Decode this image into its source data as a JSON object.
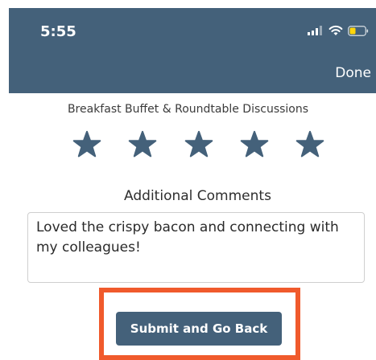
{
  "status_bar": {
    "time": "5:55"
  },
  "header": {
    "done_label": "Done"
  },
  "session": {
    "title": "Breakfast Buffet & Roundtable Discussions",
    "rating": 5,
    "max_rating": 5
  },
  "comments": {
    "label": "Additional Comments",
    "value": "Loved the crispy bacon and connecting with my colleagues!"
  },
  "actions": {
    "submit_label": "Submit and Go Back"
  },
  "colors": {
    "header_bg": "#44617a",
    "star": "#44617a",
    "button_bg": "#44617a",
    "highlight": "#f05a2c",
    "battery": "#ffd60a"
  },
  "icons": {
    "signal": "cellular-signal-icon",
    "wifi": "wifi-icon",
    "battery": "battery-icon",
    "star": "star-icon"
  }
}
